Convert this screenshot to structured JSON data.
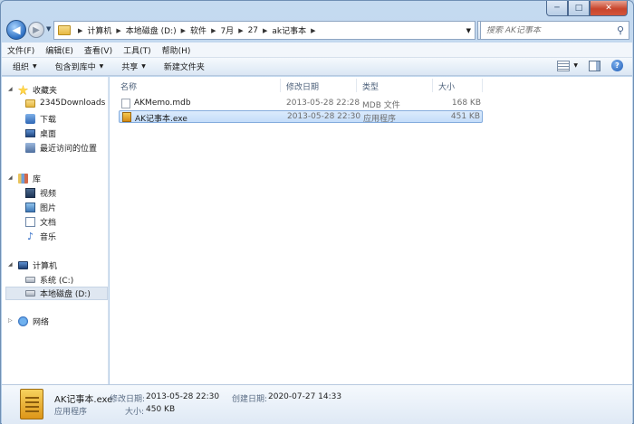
{
  "window": {
    "caption_min": "─",
    "caption_max": "□",
    "caption_close": "✕"
  },
  "address": {
    "crumbs": [
      "计算机",
      "本地磁盘 (D:)",
      "软件",
      "7月",
      "27",
      "ak记事本"
    ]
  },
  "search": {
    "placeholder": "搜索 AK记事本"
  },
  "menu": [
    "文件(F)",
    "编辑(E)",
    "查看(V)",
    "工具(T)",
    "帮助(H)"
  ],
  "toolbar": {
    "organize": "组织",
    "include_library": "包含到库中",
    "share": "共享",
    "new_folder": "新建文件夹"
  },
  "nav": {
    "favorites": "收藏夹",
    "fav_items": [
      "2345Downloads",
      "下载",
      "桌面",
      "最近访问的位置"
    ],
    "libraries": "库",
    "lib_items": [
      "视频",
      "图片",
      "文档",
      "音乐"
    ],
    "computer": "计算机",
    "drives": [
      "系统 (C:)",
      "本地磁盘 (D:)"
    ],
    "network": "网络"
  },
  "columns": {
    "name": "名称",
    "modified": "修改日期",
    "type": "类型",
    "size": "大小"
  },
  "files": [
    {
      "name": "AKMemo.mdb",
      "modified": "2013-05-28 22:28",
      "type": "MDB 文件",
      "size": "168 KB"
    },
    {
      "name": "AK记事本.exe",
      "modified": "2013-05-28 22:30",
      "type": "应用程序",
      "size": "451 KB"
    }
  ],
  "details": {
    "name": "AK记事本.exe",
    "modified_label": "修改日期:",
    "modified": "2013-05-28 22:30",
    "created_label": "创建日期:",
    "created": "2020-07-27 14:33",
    "type": "应用程序",
    "size_label": "大小:",
    "size": "450 KB"
  }
}
